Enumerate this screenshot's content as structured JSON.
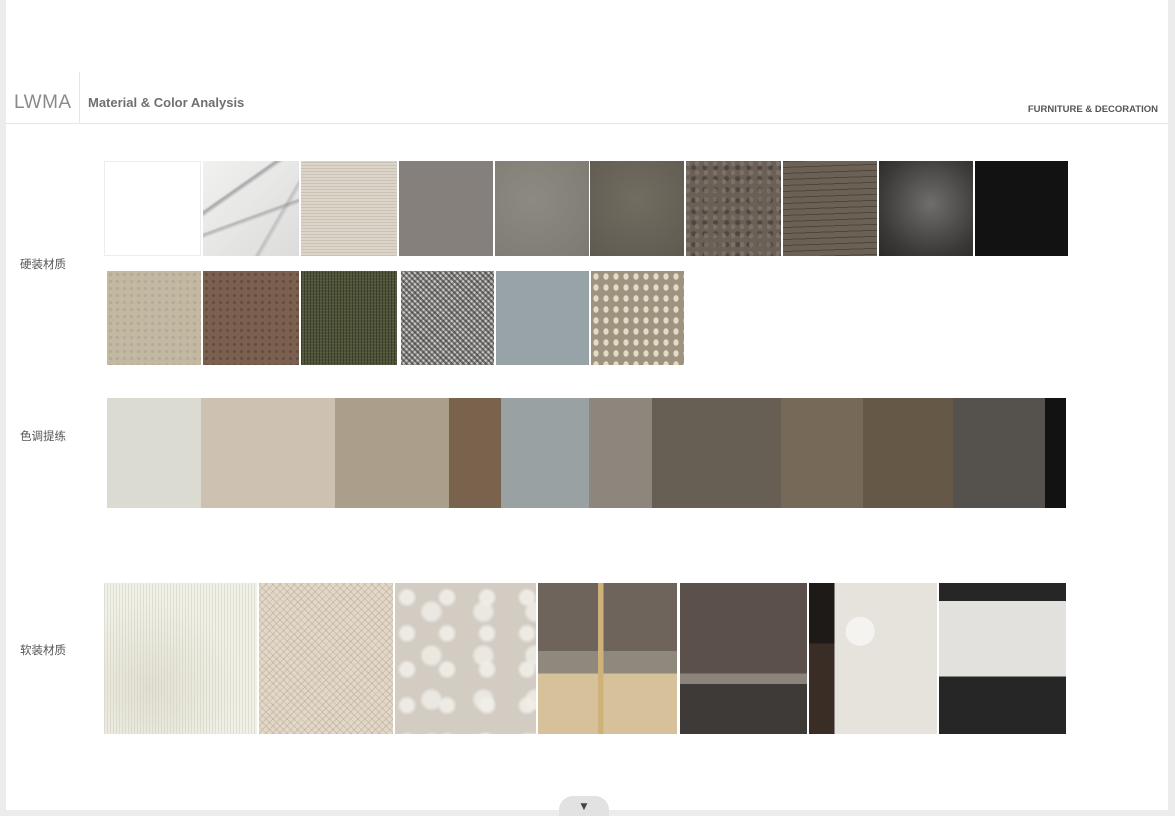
{
  "header": {
    "brand": "LWMA",
    "title": "Material & Color  Analysis",
    "category": "FURNITURE & DECORATION"
  },
  "sections": {
    "hard_materials_label": "硬装材质",
    "color_palette_label": "色调提练",
    "soft_materials_label": "软装材质"
  },
  "palette_colors": [
    "#dcdbd2",
    "#cdc2b2",
    "#ab9e8a",
    "#7a634c",
    "#9aa1a3",
    "#8c867c",
    "#675f54",
    "#766958",
    "#665847",
    "#55524e",
    "#121212"
  ],
  "palette_weights": [
    94,
    134,
    114,
    52,
    88,
    63,
    129,
    82,
    90,
    92,
    21
  ],
  "scroll_icon": "triangle-down-icon",
  "scroll_glyph": "▼"
}
